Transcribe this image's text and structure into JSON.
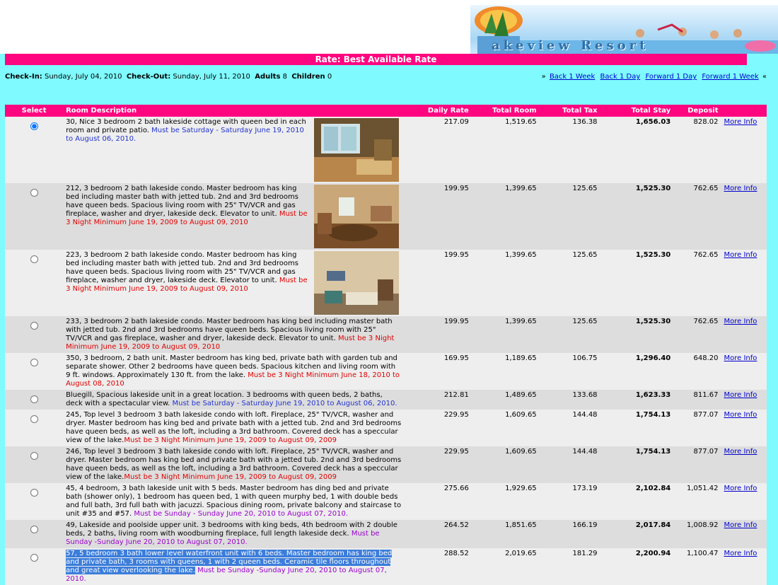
{
  "banner": {
    "logo_text": "akeview Resort"
  },
  "header": {
    "title": "Rate: Best Available Rate"
  },
  "stay_info": {
    "checkin_label": "Check-In:",
    "checkin_value": "Sunday, July 04, 2010",
    "checkout_label": "Check-Out:",
    "checkout_value": "Sunday, July 11, 2010",
    "adults_label": "Adults",
    "adults_value": "8",
    "children_label": "Children",
    "children_value": "0"
  },
  "nav": {
    "prefix": "»",
    "suffix": "«",
    "back_week": "Back 1 Week",
    "back_day": "Back 1 Day",
    "forward_day": "Forward 1 Day",
    "forward_week": "Forward 1 Week"
  },
  "table": {
    "columns": [
      "Select",
      "Room Description",
      "Daily Rate",
      "Total Room",
      "Total Tax",
      "Total Stay",
      "Deposit"
    ],
    "more_info_label": "More Info",
    "rows": [
      {
        "selected": true,
        "desc": "30, Nice 3 bedroom 2 bath lakeside cottage with queen bed in each room and private patio. ",
        "note": "Must be Saturday - Saturday June 19, 2010 to August 06, 2010.",
        "note_color": "blue",
        "daily": "217.09",
        "room": "1,519.65",
        "tax": "136.38",
        "stay": "1,656.03",
        "deposit": "828.02",
        "photo": 1
      },
      {
        "selected": false,
        "desc": "212, 3 bedroom 2 bath lakeside condo. Master bedroom has king bed including master bath with jetted tub. 2nd and 3rd bedrooms have queen beds. Spacious living room with 25\" TV/VCR and gas fireplace, washer and dryer, lakeside deck. Elevator to unit. ",
        "note": "Must be 3 Night Minimum June 19, 2009 to August 09, 2010",
        "note_color": "red",
        "daily": "199.95",
        "room": "1,399.65",
        "tax": "125.65",
        "stay": "1,525.30",
        "deposit": "762.65",
        "photo": 2
      },
      {
        "selected": false,
        "desc": "223, 3 bedroom 2 bath lakeside condo. Master bedroom has king bed including master bath with jetted tub. 2nd and 3rd bedrooms have queen beds. Spacious living room with 25\" TV/VCR and gas fireplace, washer and dryer, lakeside deck. Elevator to unit. ",
        "note": "Must be 3 Night Minimum June 19, 2009 to August 09, 2010",
        "note_color": "red",
        "daily": "199.95",
        "room": "1,399.65",
        "tax": "125.65",
        "stay": "1,525.30",
        "deposit": "762.65",
        "photo": 3
      },
      {
        "selected": false,
        "desc": "233, 3 bedroom 2 bath lakeside condo. Master bedroom has king bed including master bath with jetted tub. 2nd and 3rd bedrooms have queen beds. Spacious living room with 25\" TV/VCR and gas fireplace, washer and dryer, lakeside deck. Elevator to unit. ",
        "note": "Must be 3 Night Minimum June 19, 2009 to August 09, 2010",
        "note_color": "red",
        "daily": "199.95",
        "room": "1,399.65",
        "tax": "125.65",
        "stay": "1,525.30",
        "deposit": "762.65",
        "photo": 0
      },
      {
        "selected": false,
        "desc": "350, 3 bedroom, 2 bath unit. Master bedroom has king bed, private bath with garden tub and separate shower. Other 2 bedrooms have queen beds. Spacious kitchen and living room with 9 ft. windows. Approximately 130 ft. from the lake. ",
        "note": "Must be 3 Night Minimum June 18, 2010 to August 08, 2010",
        "note_color": "red",
        "daily": "169.95",
        "room": "1,189.65",
        "tax": "106.75",
        "stay": "1,296.40",
        "deposit": "648.20",
        "photo": 0
      },
      {
        "selected": false,
        "desc": "Bluegill, Spacious lakeside unit in a great location. 3 bedrooms with queen beds, 2 baths, deck with a spectacular view. ",
        "note": "Must be Saturday - Saturday June 19, 2010 to August 06, 2010.",
        "note_color": "blue",
        "daily": "212.81",
        "room": "1,489.65",
        "tax": "133.68",
        "stay": "1,623.33",
        "deposit": "811.67",
        "photo": 0
      },
      {
        "selected": false,
        "desc": "245, Top level 3 bedroom 3 bath lakeside condo with loft. Fireplace, 25\" TV/VCR, washer and dryer. Master bedroom has king bed and private bath with a jetted tub. 2nd and 3rd bedrooms have queen beds, as well as the loft, including a 3rd bathroom. Covered deck has a speccular view of the lake.",
        "note": "Must be 3 Night Minimum June 19, 2009 to August 09, 2009",
        "note_color": "red",
        "daily": "229.95",
        "room": "1,609.65",
        "tax": "144.48",
        "stay": "1,754.13",
        "deposit": "877.07",
        "photo": 0
      },
      {
        "selected": false,
        "desc": "246, Top level 3 bedroom 3 bath lakeside condo with loft. Fireplace, 25\" TV/VCR, washer and dryer. Master bedroom has king bed and private bath with a jetted tub. 2nd and 3rd bedrooms have queen beds, as well as the loft, including a 3rd bathroom. Covered deck has a speccular view of the lake.",
        "note": "Must be 3 Night Minimum June 19, 2009 to August 09, 2009",
        "note_color": "red",
        "daily": "229.95",
        "room": "1,609.65",
        "tax": "144.48",
        "stay": "1,754.13",
        "deposit": "877.07",
        "photo": 0
      },
      {
        "selected": false,
        "desc": "45, 4 bedroom, 3 bath lakeside unit with 5 beds. Master bedroom has ding bed and private bath (shower only), 1 bedroom has queen bed, 1 with queen murphy bed, 1 with double beds and full bath, 3rd full bath with jacuzzi. Spacious dining room, private balcony and staircase to unit #35 and #57. ",
        "note": "Must be Sunday - Sunday June 20, 2010 to August 07, 2010.",
        "note_color": "purple",
        "daily": "275.66",
        "room": "1,929.65",
        "tax": "173.19",
        "stay": "2,102.84",
        "deposit": "1,051.42",
        "photo": 0
      },
      {
        "selected": false,
        "desc": "49, Lakeside and poolside upper unit. 3 bedrooms with king beds, 4th bedroom with 2 double beds, 2 baths, living room with woodburning fireplace, full length lakeside deck. ",
        "note": "Must be Sunday -Sunday June 20, 2010 to August 07, 2010.",
        "note_color": "purple",
        "daily": "264.52",
        "room": "1,851.65",
        "tax": "166.19",
        "stay": "2,017.84",
        "deposit": "1,008.92",
        "photo": 0
      },
      {
        "selected": false,
        "desc": "57, 5 bedroom 3 bath lower level waterfront unit with 6 beds. Master bedroom has king bed and private bath, 3 rooms with queens, 1 with 2 queen beds. Ceramic tile floors throughout and great view overlooking the lake.",
        "note": " Must be Sunday -Sunday June 20, 2010 to August 07, 2010.",
        "note_color": "purple",
        "highlight": true,
        "daily": "288.52",
        "room": "2,019.65",
        "tax": "181.29",
        "stay": "2,200.94",
        "deposit": "1,100.47",
        "photo": 0
      }
    ]
  }
}
